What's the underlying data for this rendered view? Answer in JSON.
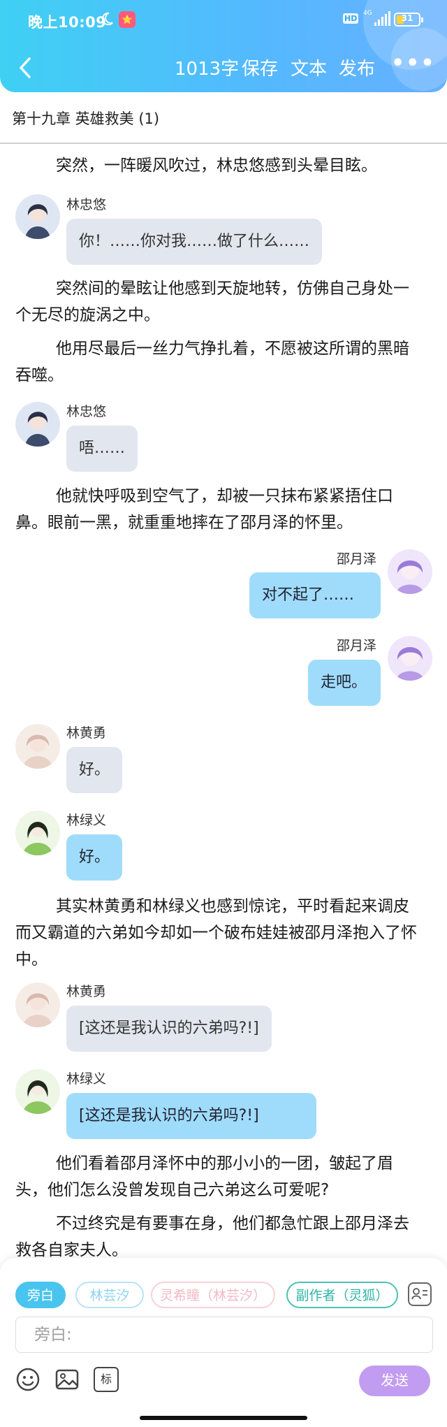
{
  "status_bar": {
    "time": "晚上10:09",
    "app_badge": "⭐",
    "hd": "HD",
    "network": "4G",
    "battery": "31"
  },
  "navbar": {
    "word_count": "1013字",
    "save": "保存",
    "text": "文本",
    "publish": "发布",
    "more": "•••"
  },
  "chapter": {
    "title": "第十九章 英雄救美 (1)"
  },
  "content": {
    "p1": "突然，一阵暖风吹过，林忠悠感到头晕目眩。",
    "m1_speaker": "林忠悠",
    "m1_text": "你！……你对我……做了什么……",
    "p2": "突然间的晕眩让他感到天旋地转，仿佛自己身处一个无尽的旋涡之中。",
    "p3": "他用尽最后一丝力气挣扎着，不愿被这所谓的黑暗吞噬。",
    "m2_speaker": "林忠悠",
    "m2_text": "唔……",
    "p4": "他就快呼吸到空气了，却被一只抹布紧紧捂住口鼻。眼前一黑，就重重地摔在了邵月泽的怀里。",
    "m3_speaker": "邵月泽",
    "m3_text": "对不起了……",
    "m4_speaker": "邵月泽",
    "m4_text": "走吧。",
    "m5_speaker": "林黄勇",
    "m5_text": "好。",
    "m6_speaker": "林绿义",
    "m6_text": "好。",
    "p5": "其实林黄勇和林绿义也感到惊诧，平时看起来调皮而又霸道的六弟如今却如一个破布娃娃被邵月泽抱入了怀中。",
    "m7_speaker": "林黄勇",
    "m7_text": "[这还是我认识的六弟吗?!]",
    "m8_speaker": "林绿义",
    "m8_text": "[这还是我认识的六弟吗?!]",
    "p6": "他们看着邵月泽怀中的那小小的一团，皱起了眉头，他们怎么没曾发现自己六弟这么可爱呢?",
    "p7": "不过终究是有要事在身，他们都急忙跟上邵月泽去救各自家夫人。"
  },
  "bottom": {
    "roles": [
      "旁白",
      "林芸汐",
      "灵希瞳（林芸汐）",
      "副作者（灵狐）"
    ],
    "input_placeholder": "旁白:",
    "mark_label": "标",
    "send": "发送"
  },
  "colors": {
    "header_gradient_start": "#3fd0f3",
    "header_gradient_end": "#66b0ff",
    "bubble_left": "#e2e6ef",
    "bubble_right": "#9fdcfb",
    "send_button": "#c29cf0"
  }
}
